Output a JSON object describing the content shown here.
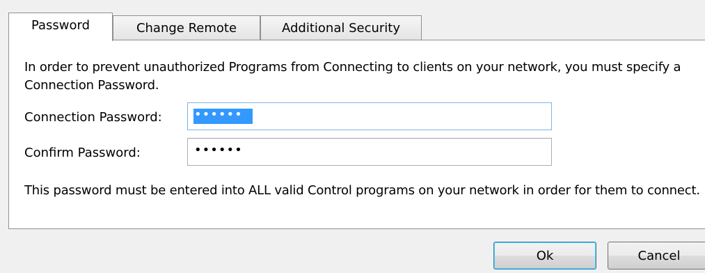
{
  "tabs": [
    {
      "label": "Password",
      "active": true
    },
    {
      "label": "Change Remote",
      "active": false
    },
    {
      "label": "Additional Security",
      "active": false
    }
  ],
  "panel": {
    "intro_text": "In order to prevent unauthorized Programs from Connecting to clients on your network, you must specify a Connection Password.",
    "connection_password_label": "Connection Password:",
    "connection_password_masked": "••••••",
    "confirm_password_label": "Confirm Password:",
    "confirm_password_masked": "••••••",
    "note_text": "This password must be entered into ALL valid Control programs on your network in order for them to connect."
  },
  "buttons": {
    "ok_label": "Ok",
    "cancel_label": "Cancel"
  },
  "colors": {
    "selection": "#3399ff",
    "focus_border": "#7eb4ea",
    "default_button_border": "#3c7fb1"
  }
}
